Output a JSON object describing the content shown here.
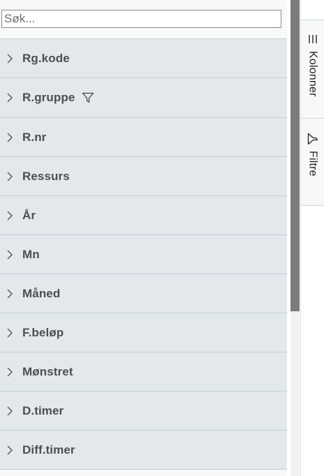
{
  "search": {
    "placeholder": "Søk..."
  },
  "filters": {
    "items": [
      {
        "label": "Rg.kode"
      },
      {
        "label": "R.gruppe"
      },
      {
        "label": "R.nr"
      },
      {
        "label": "Ressurs"
      },
      {
        "label": "År"
      },
      {
        "label": "Mn"
      },
      {
        "label": "Måned"
      },
      {
        "label": "F.beløp"
      },
      {
        "label": "Mønstret"
      },
      {
        "label": "D.timer"
      },
      {
        "label": "Diff.timer"
      }
    ]
  },
  "side_bar": {
    "columns_label": "Kolonner",
    "filters_label": "Filtre"
  }
}
